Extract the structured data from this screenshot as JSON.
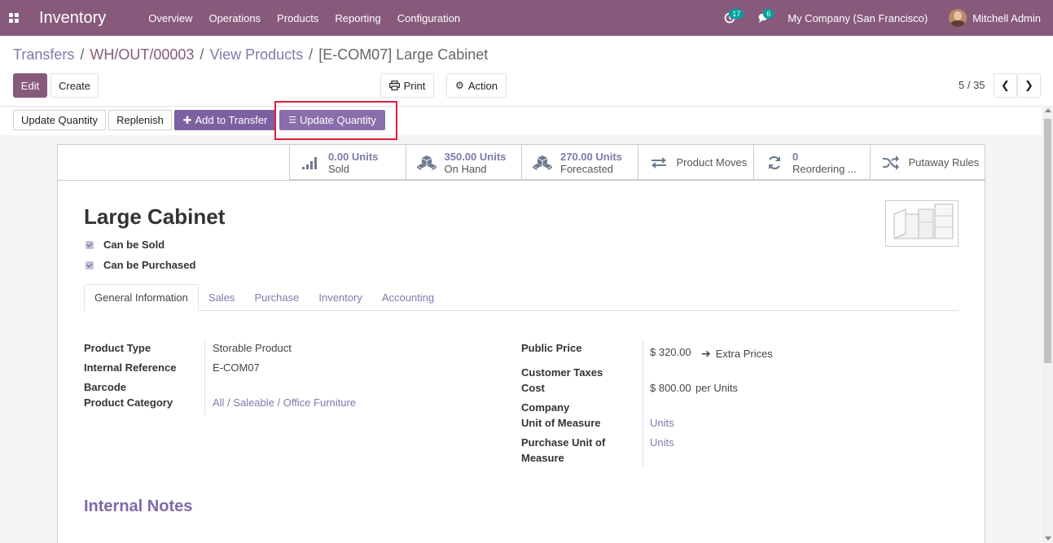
{
  "navbar": {
    "app_name": "Inventory",
    "menu": [
      "Overview",
      "Operations",
      "Products",
      "Reporting",
      "Configuration"
    ],
    "activity_count": "17",
    "message_count": "6",
    "company": "My Company (San Francisco)",
    "user": "Mitchell Admin"
  },
  "breadcrumb": {
    "items": [
      "Transfers",
      "WH/OUT/00003",
      "View Products"
    ],
    "current": "[E-COM07] Large Cabinet",
    "separator": "/"
  },
  "control": {
    "edit": "Edit",
    "create": "Create",
    "print": "Print",
    "action": "Action",
    "pager": "5 / 35"
  },
  "header_buttons": {
    "update_quantity": "Update Quantity",
    "replenish": "Replenish",
    "add_to_transfer": "Add to Transfer",
    "update_quantity_2": "Update Quantity"
  },
  "smart_buttons": [
    {
      "value": "0.00 Units",
      "label": "Sold",
      "icon": "signal-icon"
    },
    {
      "value": "350.00 Units",
      "label": "On Hand",
      "icon": "cubes-icon"
    },
    {
      "value": "270.00 Units",
      "label": "Forecasted",
      "icon": "cubes-icon"
    },
    {
      "label": "Product Moves",
      "icon": "exchange-icon"
    },
    {
      "value": "0",
      "label": "Reordering ...",
      "icon": "refresh-icon"
    },
    {
      "label": "Putaway Rules",
      "icon": "random-icon"
    }
  ],
  "product": {
    "name": "Large Cabinet",
    "can_be_sold": "Can be Sold",
    "can_be_purchased": "Can be Purchased"
  },
  "tabs": [
    "General Information",
    "Sales",
    "Purchase",
    "Inventory",
    "Accounting"
  ],
  "fields_left": {
    "product_type_label": "Product Type",
    "product_type": "Storable Product",
    "internal_ref_label": "Internal Reference",
    "internal_ref": "E-COM07",
    "barcode_label": "Barcode",
    "category_label": "Product Category",
    "category": "All / Saleable / Office Furniture"
  },
  "fields_right": {
    "public_price_label": "Public Price",
    "public_price": "$ 320.00",
    "extra_prices": "Extra Prices",
    "customer_taxes_label": "Customer Taxes",
    "cost_label": "Cost",
    "cost": "$ 800.00",
    "cost_unit": "per Units",
    "company_label": "Company",
    "uom_label": "Unit of Measure",
    "uom": "Units",
    "purchase_uom_label_1": "Purchase Unit of",
    "purchase_uom_label_2": "Measure",
    "purchase_uom": "Units"
  },
  "notes_title": "Internal Notes",
  "colors": {
    "brand": "#875a7b",
    "link": "#7c7bad",
    "highlight": "#e21d3a"
  }
}
